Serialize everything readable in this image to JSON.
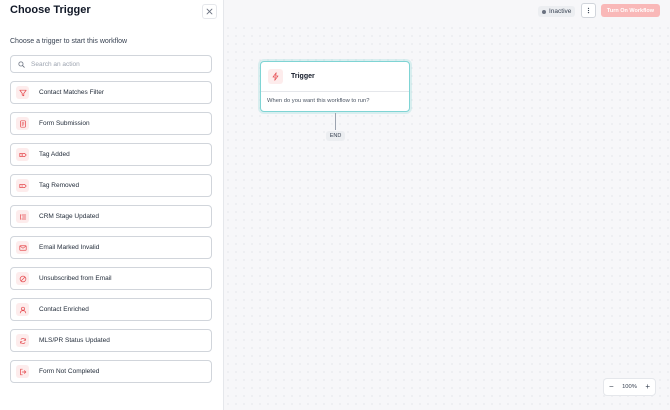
{
  "panel": {
    "title": "Choose Trigger",
    "subtitle": "Choose a trigger to start this workflow",
    "search_placeholder": "Search an action",
    "triggers": [
      {
        "label": "Contact Matches Filter",
        "icon": "filter-icon"
      },
      {
        "label": "Form Submission",
        "icon": "form-icon"
      },
      {
        "label": "Tag Added",
        "icon": "tag-icon"
      },
      {
        "label": "Tag Removed",
        "icon": "tag-icon"
      },
      {
        "label": "CRM Stage Updated",
        "icon": "list-icon"
      },
      {
        "label": "Email Marked Invalid",
        "icon": "mail-x-icon"
      },
      {
        "label": "Unsubscribed from Email",
        "icon": "ban-icon"
      },
      {
        "label": "Contact Enriched",
        "icon": "user-icon"
      },
      {
        "label": "MLS/PR Status Updated",
        "icon": "refresh-icon"
      },
      {
        "label": "Form Not Completed",
        "icon": "exit-icon"
      }
    ]
  },
  "toolbar": {
    "status": "Inactive",
    "turn_on_label": "Turn On Workflow"
  },
  "node": {
    "title": "Trigger",
    "subtitle": "When do you want this workflow to run?"
  },
  "end_label": "END",
  "zoom": {
    "minus": "−",
    "level": "100%",
    "plus": "+"
  },
  "colors": {
    "accent": "#e5484d",
    "icon_bg": "#fdecec",
    "node_border": "#7fd4d4",
    "turn_on_bg": "#f9b8b8"
  }
}
